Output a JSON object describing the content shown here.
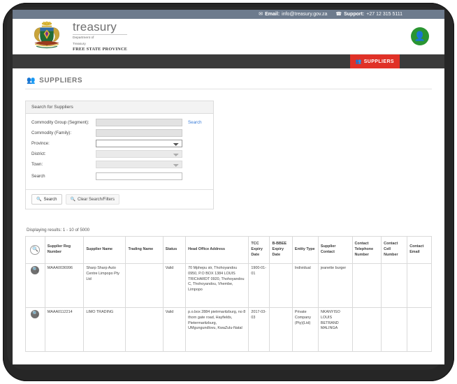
{
  "topbar": {
    "email_label": "Email:",
    "email_value": "info@treasury.gov.za",
    "support_label": "Support:",
    "support_value": "+27 12 315 5111",
    "email_icon": "envelope-icon",
    "support_icon": "phone-icon",
    "bg_color": "#6d7b8d"
  },
  "brand": {
    "name": "treasury",
    "dept_line1": "Department of",
    "dept_line2": "Treasury",
    "province": "FREE STATE PROVINCE",
    "logo_icon": "coat-of-arms-icon",
    "avatar_icon": "user-icon",
    "avatar_color": "#2a9532"
  },
  "nav": {
    "items": [
      {
        "label": "SUPPLIERS",
        "icon": "suppliers-icon",
        "active": true,
        "color": "#e03127"
      }
    ]
  },
  "page": {
    "title": "SUPPLIERS",
    "title_icon": "users-icon"
  },
  "search_panel": {
    "heading": "Search for Suppliers",
    "fields": [
      {
        "label": "Commodity Group (Segment):",
        "value": "",
        "type": "text-disabled",
        "link": "Search"
      },
      {
        "label": "Commodity (Family):",
        "value": "",
        "type": "text-disabled",
        "link": ""
      },
      {
        "label": "Province:",
        "value": "",
        "type": "select-enabled",
        "link": ""
      },
      {
        "label": "District:",
        "value": "",
        "type": "select-disabled",
        "link": ""
      },
      {
        "label": "Town:",
        "value": "",
        "type": "select-disabled",
        "link": ""
      },
      {
        "label": "Search",
        "value": "",
        "type": "text-enabled",
        "link": ""
      }
    ],
    "buttons": [
      {
        "label": "Search",
        "icon": "magnifier-icon",
        "style": "default"
      },
      {
        "label": "Clear Search/Filters",
        "icon": "magnifier-icon",
        "style": "plain"
      }
    ]
  },
  "results": {
    "summary": "Displaying results: 1 - 10 of 5000",
    "columns": [
      "",
      "Supplier Reg Number",
      "Supplier Name",
      "Trading Name",
      "Status",
      "Head Office Address",
      "TCC Expiry Date",
      "B-BBEE Expiry Date",
      "Entity Type",
      "Supplier Contact",
      "Contact Telephone Number",
      "Contact Cell Number",
      "Contact Email"
    ],
    "header_icon": "magnifier-icon",
    "row_icon": "view-detail-icon",
    "rows": [
      {
        "reg_number": "MAAA0036996",
        "supplier_name": "Sharp Sharp Auto Centre Limpopo Pty Ltd",
        "trading_name": "",
        "status": "Valid",
        "head_office_address": "70 Mphepu str, Thohoyandou 0950, P.O BOX 1384 LOUIS TRICHARDT 0920, Thohoyandou C, Thohoyandou, Vhembe, Limpopo",
        "tcc_expiry_date": "1900-01-01",
        "bbbee_expiry_date": "",
        "entity_type": "Individual",
        "supplier_contact": "jeanette burger",
        "contact_telephone": "",
        "contact_cell": "",
        "contact_email": ""
      },
      {
        "reg_number": "MAAA0112214",
        "supplier_name": "LIMO TRADING",
        "trading_name": "",
        "status": "Valid",
        "head_office_address": "p.o.box 2884 pietrmaritzburg, no 8 thorn gate road, Hayfields, Pietermaritzburg, UMgungundlovu, KwaZulu-Natal",
        "tcc_expiry_date": "2017-03-03",
        "bbbee_expiry_date": "",
        "entity_type": "Private Company (Pty)(Ltd)",
        "supplier_contact": "NKANYISO LOUIS BETRAND MALINGA",
        "contact_telephone": "",
        "contact_cell": "",
        "contact_email": ""
      }
    ]
  }
}
